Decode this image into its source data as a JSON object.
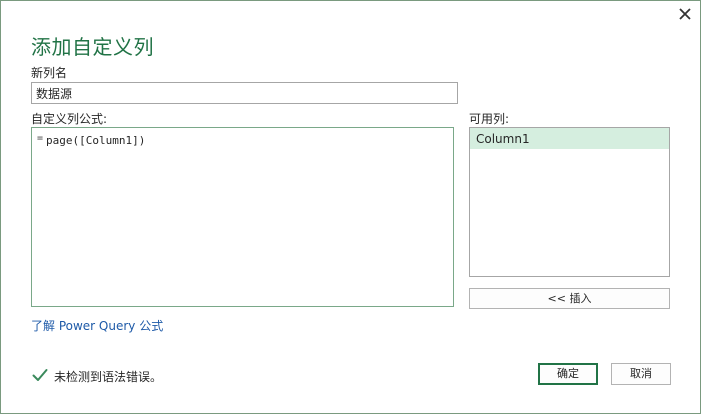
{
  "dialog": {
    "title": "添加自定义列",
    "close_icon": "close-icon"
  },
  "new_column": {
    "label": "新列名",
    "value": "数据源"
  },
  "formula": {
    "label": "自定义列公式:",
    "prefix": "=",
    "value": "page([Column1])"
  },
  "available": {
    "label": "可用列:",
    "items": [
      "Column1"
    ],
    "selected_color": "#d5eedf"
  },
  "buttons": {
    "insert": "<< 插入",
    "ok": "确定",
    "cancel": "取消"
  },
  "help_link": "了解 Power Query 公式",
  "status": {
    "icon": "checkmark-icon",
    "text": "未检测到语法错误。"
  },
  "colors": {
    "accent": "#217346",
    "link": "#1e5aa8"
  }
}
